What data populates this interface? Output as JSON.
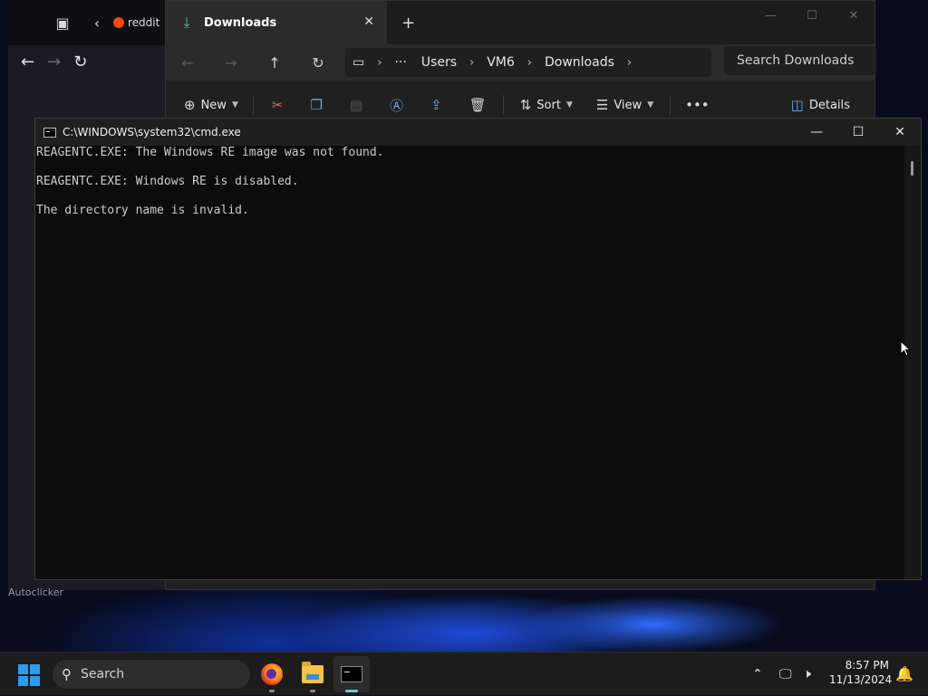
{
  "browser": {
    "tab_label": "reddit",
    "footer_label": "Autoclicker"
  },
  "explorer": {
    "tab_title": "Downloads",
    "breadcrumb": [
      "Users",
      "VM6",
      "Downloads"
    ],
    "search_placeholder": "Search Downloads",
    "toolbar": {
      "new_label": "New",
      "sort_label": "Sort",
      "view_label": "View",
      "details_label": "Details"
    }
  },
  "cmd": {
    "title": "C:\\WINDOWS\\system32\\cmd.exe",
    "lines": [
      "REAGENTC.EXE: The Windows RE image was not found.",
      "",
      "REAGENTC.EXE: Windows RE is disabled.",
      "",
      "The directory name is invalid."
    ]
  },
  "taskbar": {
    "search_label": "Search",
    "time": "8:57 PM",
    "date": "11/13/2024"
  },
  "icons": {
    "start": "windows-logo-icon",
    "browser_app": "firefox-icon",
    "explorer_app": "file-explorer-icon",
    "terminal_app": "command-prompt-icon"
  },
  "colors": {
    "accent": "#60cdff",
    "start_blue": "#2a9cf2",
    "downloads_green": "#4cc38a"
  }
}
